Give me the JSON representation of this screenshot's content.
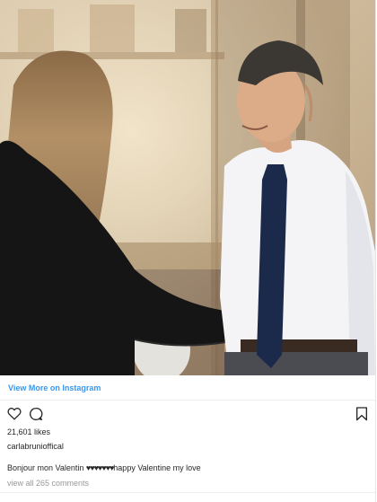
{
  "post": {
    "view_more_label": "View More on Instagram",
    "likes": "21,601 likes",
    "username": "carlabrunioffical",
    "caption_start": "Bonjour mon Valentin ",
    "caption_hearts": "♥♥♥♥♥♥♥",
    "caption_end": "happy Valentine my love",
    "comments_label": "view all 265 comments"
  },
  "icons": {
    "like": "heart-outline-icon",
    "comment": "comment-bubble-icon",
    "save": "bookmark-icon"
  },
  "colors": {
    "link": "#3897f0",
    "text": "#262626",
    "muted": "#999999"
  }
}
